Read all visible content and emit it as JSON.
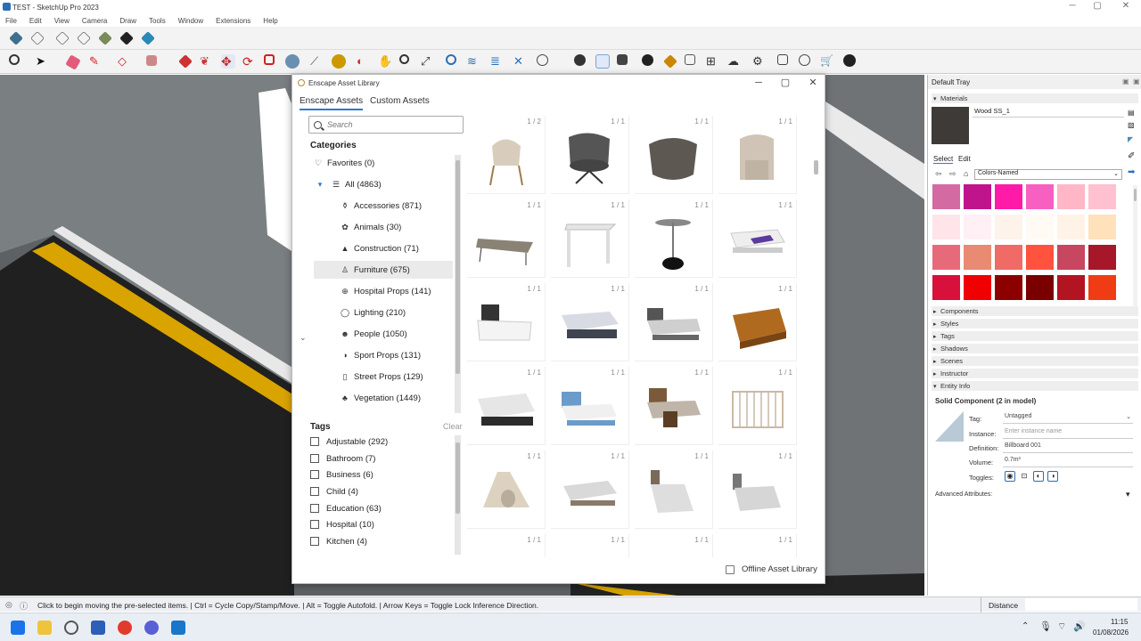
{
  "window": {
    "title": "TEST - SketchUp Pro 2023"
  },
  "menu": [
    "File",
    "Edit",
    "View",
    "Camera",
    "Draw",
    "Tools",
    "Window",
    "Extensions",
    "Help"
  ],
  "dialog": {
    "title": "Enscape Asset Library",
    "tabs": [
      "Enscape Assets",
      "Custom Assets"
    ],
    "search_placeholder": "Search",
    "categories_header": "Categories",
    "categories": [
      {
        "label": "Favorites (0)",
        "icon": "heart-icon"
      },
      {
        "label": "All (4863)",
        "icon": "list-icon"
      },
      {
        "label": "Accessories (871)",
        "icon": "accessories-icon"
      },
      {
        "label": "Animals (30)",
        "icon": "paw-icon"
      },
      {
        "label": "Construction (71)",
        "icon": "cone-icon"
      },
      {
        "label": "Furniture (675)",
        "icon": "chair-icon"
      },
      {
        "label": "Hospital Props (141)",
        "icon": "hospital-icon"
      },
      {
        "label": "Lighting (210)",
        "icon": "bulb-icon"
      },
      {
        "label": "People (1050)",
        "icon": "people-icon"
      },
      {
        "label": "Sport Props (131)",
        "icon": "sport-icon"
      },
      {
        "label": "Street Props (129)",
        "icon": "street-icon"
      },
      {
        "label": "Vegetation (1449)",
        "icon": "tree-icon"
      }
    ],
    "tags_header": "Tags",
    "tags_clear": "Clear",
    "tags": [
      "Adjustable (292)",
      "Bathroom (7)",
      "Business (6)",
      "Child (4)",
      "Education (63)",
      "Hospital (10)",
      "Kitchen (4)"
    ],
    "asset_counts": [
      "1 / 2",
      "1 / 1",
      "1 / 1",
      "1 / 1",
      "1 / 1",
      "1 / 1",
      "1 / 1",
      "1 / 1",
      "1 / 1",
      "1 / 1",
      "1 / 1",
      "1 / 1",
      "1 / 1",
      "1 / 1",
      "1 / 1",
      "1 / 1",
      "1 / 1",
      "1 / 1",
      "1 / 1",
      "1 / 1",
      "1 / 1",
      "1 / 1",
      "1 / 1",
      "1 / 1"
    ],
    "offline_label": "Offline Asset Library"
  },
  "tray": {
    "title": "Default Tray",
    "materials_label": "Materials",
    "material_name": "Wood SS_1",
    "select_tab": "Select",
    "edit_tab": "Edit",
    "library": "Colors-Named",
    "sections": [
      "Components",
      "Styles",
      "Tags",
      "Shadows",
      "Scenes",
      "Instructor",
      "Entity Info"
    ],
    "entity": {
      "heading": "Solid Component (2 in model)",
      "tag_label": "Tag:",
      "tag_value": "Untagged",
      "instance_label": "Instance:",
      "instance_placeholder": "Enter instance name",
      "definition_label": "Definition:",
      "definition_value": "Billboard 001",
      "volume_label": "Volume:",
      "volume_value": "0.7m³",
      "toggles_label": "Toggles:",
      "advanced": "Advanced Attributes:"
    }
  },
  "status": {
    "message": "Click to begin moving the pre-selected items.  | Ctrl = Cycle Copy/Stamp/Move.  | Alt = Toggle Autofold.  | Arrow Keys = Toggle Lock Inference Direction.",
    "measure_label": "Distance"
  },
  "taskbar": {
    "time": "11:15",
    "date": "01/08/2026"
  }
}
